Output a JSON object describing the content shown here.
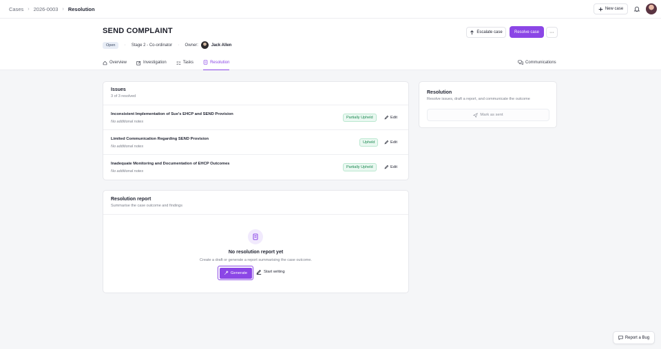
{
  "breadcrumb": {
    "items": [
      "Cases",
      "2026-0003"
    ],
    "current": "Resolution",
    "separator": "›"
  },
  "topbar": {
    "new_case_label": "New case",
    "new_case_icon": "plus-icon",
    "notifications_icon": "bell-icon"
  },
  "case": {
    "title": "SEND COMPLAINT",
    "status": "Open",
    "stage": "Stage 2 - Co-ordinator",
    "owner_label": "Owner:",
    "owner_name": "Jack Allen",
    "meta_separator": "·"
  },
  "actions": {
    "escalate_label": "Escalate case",
    "resolve_label": "Resolve case",
    "more_label": "···"
  },
  "tabs": [
    {
      "label": "Overview",
      "icon": "home-icon"
    },
    {
      "label": "Investigation",
      "icon": "edit-square-icon"
    },
    {
      "label": "Tasks",
      "icon": "list-check-icon"
    },
    {
      "label": "Resolution",
      "icon": "document-icon",
      "active": true
    }
  ],
  "communications_label": "Communications",
  "issues": {
    "title": "Issues",
    "subtitle": "3 of 3 resolved",
    "edit_label": "Edit",
    "items": [
      {
        "name": "Inconsistent Implementation of Sue's EHCP and SEND Provision",
        "note": "No additional notes",
        "status": "Partially Upheld"
      },
      {
        "name": "Limited Communication Regarding SEND Provision",
        "note": "No additional notes",
        "status": "Upheld"
      },
      {
        "name": "Inadequate Monitoring and Documentation of EHCP Outcomes",
        "note": "No additional notes",
        "status": "Partially Upheld"
      }
    ]
  },
  "report": {
    "title": "Resolution report",
    "subtitle": "Summarise the case outcome and findings",
    "empty_title": "No resolution report yet",
    "empty_subtitle": "Create a draft or generate a report summarising the case outcome.",
    "generate_label": "Generate",
    "start_writing_label": "Start writing"
  },
  "resolution_panel": {
    "title": "Resolution",
    "subtitle": "Resolve issues, draft a report, and communicate the outcome",
    "mark_sent_label": "Mark as sent"
  },
  "report_bug_label": "Report a Bug",
  "colors": {
    "accent": "#8b46e6",
    "upheld_bg": "#eaf8f1",
    "upheld_text": "#1d8a52"
  }
}
